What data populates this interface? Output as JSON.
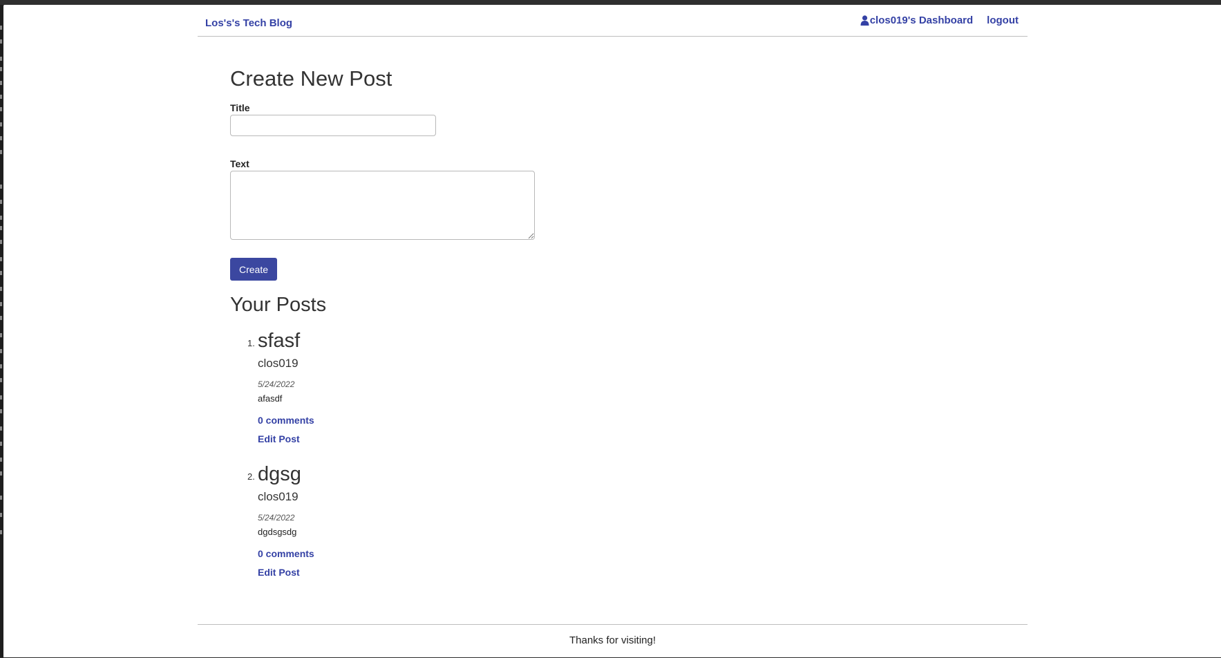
{
  "header": {
    "brand": "Los's's Tech Blog",
    "dashboard_label": "clos019's Dashboard",
    "logout_label": "logout"
  },
  "create_post": {
    "heading": "Create New Post",
    "title_label": "Title",
    "title_value": "",
    "text_label": "Text",
    "text_value": "",
    "submit_label": "Create"
  },
  "your_posts": {
    "heading": "Your Posts",
    "posts": [
      {
        "number": "1.",
        "title": "sfasf",
        "author": "clos019",
        "date": "5/24/2022",
        "body": "afasdf",
        "comments_label": "0 comments",
        "edit_label": "Edit Post"
      },
      {
        "number": "2.",
        "title": "dgsg",
        "author": "clos019",
        "date": "5/24/2022",
        "body": "dgdsgsdg",
        "comments_label": "0 comments",
        "edit_label": "Edit Post"
      }
    ]
  },
  "footer": {
    "text": "Thanks for visiting!"
  },
  "colors": {
    "link": "#3441a5",
    "button": "#3b47a0",
    "divider": "#bdbdbd"
  },
  "icons": {
    "user": "user-icon"
  }
}
